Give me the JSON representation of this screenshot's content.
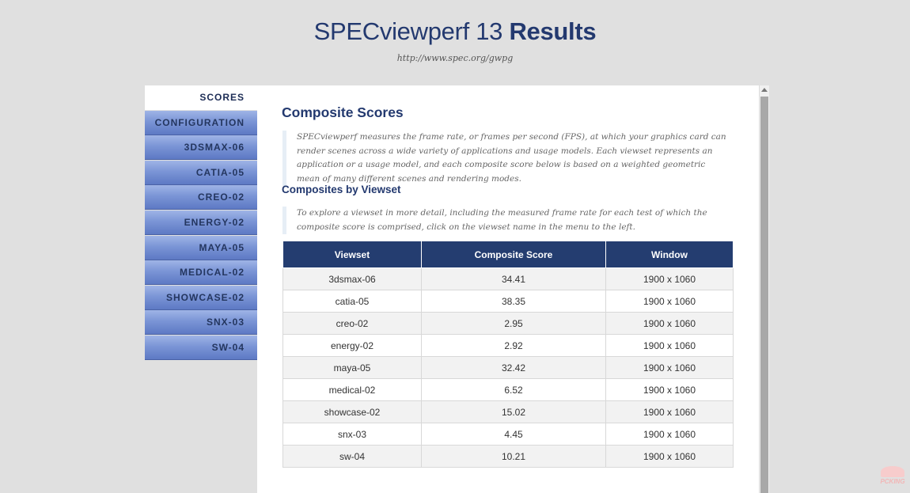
{
  "header": {
    "title_light": "SPECviewperf 13 ",
    "title_bold": "Results",
    "url": "http://www.spec.org/gwpg"
  },
  "sidebar": {
    "items": [
      {
        "label": "SCORES",
        "active": true
      },
      {
        "label": "CONFIGURATION",
        "active": false
      },
      {
        "label": "3DSMAX-06",
        "active": false
      },
      {
        "label": "CATIA-05",
        "active": false
      },
      {
        "label": "CREO-02",
        "active": false
      },
      {
        "label": "ENERGY-02",
        "active": false
      },
      {
        "label": "MAYA-05",
        "active": false
      },
      {
        "label": "MEDICAL-02",
        "active": false
      },
      {
        "label": "SHOWCASE-02",
        "active": false
      },
      {
        "label": "SNX-03",
        "active": false
      },
      {
        "label": "SW-04",
        "active": false
      }
    ]
  },
  "main": {
    "title": "Composite Scores",
    "intro": "SPECviewperf measures the frame rate, or frames per second (FPS), at which your graphics card can render scenes across a wide variety of applications and usage models. Each viewset represents an application or a usage model, and each composite score below is based on a weighted geometric mean of many different scenes and rendering modes.",
    "subtitle": "Composites by Viewset",
    "hint": "To explore a viewset in more detail, including the measured frame rate for each test of which the composite score is comprised, click on the viewset name in the menu to the left.",
    "table": {
      "headers": [
        "Viewset",
        "Composite Score",
        "Window"
      ],
      "rows": [
        [
          "3dsmax-06",
          "34.41",
          "1900 x 1060"
        ],
        [
          "catia-05",
          "38.35",
          "1900 x 1060"
        ],
        [
          "creo-02",
          "2.95",
          "1900 x 1060"
        ],
        [
          "energy-02",
          "2.92",
          "1900 x 1060"
        ],
        [
          "maya-05",
          "32.42",
          "1900 x 1060"
        ],
        [
          "medical-02",
          "6.52",
          "1900 x 1060"
        ],
        [
          "showcase-02",
          "15.02",
          "1900 x 1060"
        ],
        [
          "snx-03",
          "4.45",
          "1900 x 1060"
        ],
        [
          "sw-04",
          "10.21",
          "1900 x 1060"
        ]
      ]
    }
  },
  "watermark": "PCKING",
  "colors": {
    "page_bg": "#e0e0e0",
    "accent": "#23396f",
    "table_header": "#243d70",
    "nav_button": "#7b95d6"
  }
}
